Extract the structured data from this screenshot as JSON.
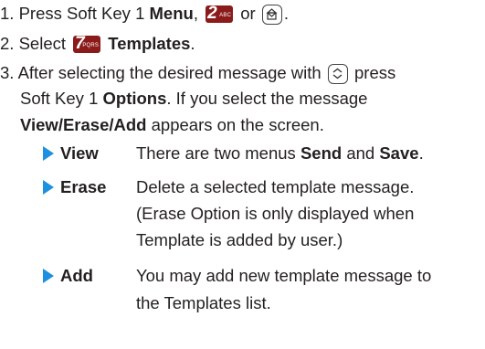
{
  "steps": [
    {
      "num": "1.",
      "text_a": "Press Soft Key 1 ",
      "bold_a": "Menu",
      "text_b": ", ",
      "key": {
        "digit": "2",
        "sub": "ABC"
      },
      "text_c": " or ",
      "text_d": "."
    },
    {
      "num": "2.",
      "text_a": "Select ",
      "key": {
        "digit": "7",
        "sub": "PQRS"
      },
      "bold_a": "Templates",
      "text_b": "."
    },
    {
      "num": "3.",
      "line1_a": "After selecting the desired message with ",
      "line1_b": " press",
      "line2_a": "Soft Key 1 ",
      "line2_bold": "Options",
      "line2_b": ". If you select the message",
      "line3_bold": "View/Erase/Add",
      "line3_b": " appears on the screen."
    }
  ],
  "options": [
    {
      "term": "View",
      "lines": [
        {
          "a": "There are two menus ",
          "b1": "Send",
          "c": " and ",
          "b2": "Save",
          "d": "."
        }
      ]
    },
    {
      "term": "Erase",
      "lines": [
        {
          "a": "Delete a selected template message."
        },
        {
          "a": "(Erase Option is only displayed when"
        },
        {
          "a": "Template is added by user.)"
        }
      ]
    },
    {
      "term": "Add",
      "lines": [
        {
          "a": "You may add new template message to"
        },
        {
          "a": "the Templates list."
        }
      ]
    }
  ],
  "colors": {
    "text": "#231f20",
    "bullet": "#1e90e0",
    "keypad": "#8b1a1a"
  },
  "icons": [
    "message-envelope-key-icon",
    "navigation-updown-key-icon"
  ]
}
